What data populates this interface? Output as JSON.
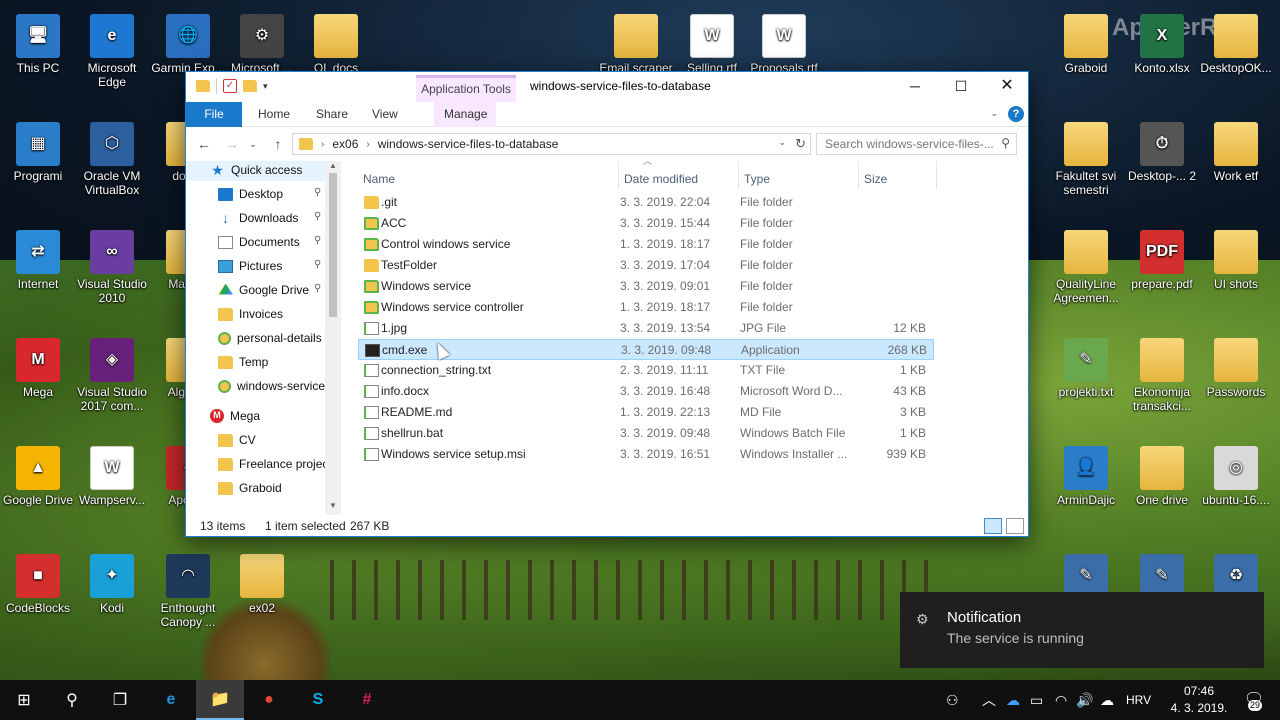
{
  "desktop": {
    "watermark": "ApowerREC",
    "icons": [
      {
        "label": "This PC",
        "glyph": "🖥"
      },
      {
        "label": "Microsoft Edge",
        "glyph": "e"
      },
      {
        "label": "Garmin Exp...",
        "glyph": "🌐"
      },
      {
        "label": "Microsoft ...",
        "glyph": "⚙"
      },
      {
        "label": "OL docs",
        "glyph": ""
      },
      {
        "label": "Email scraper",
        "glyph": ""
      },
      {
        "label": "Selling.rtf",
        "glyph": "W"
      },
      {
        "label": "Proposals.rtf",
        "glyph": "W"
      },
      {
        "label": "Graboid",
        "glyph": ""
      },
      {
        "label": "Konto.xlsx",
        "glyph": "X"
      },
      {
        "label": "DesktopOK...",
        "glyph": ""
      },
      {
        "label": "Programi",
        "glyph": "▦"
      },
      {
        "label": "Oracle VM VirtualBox",
        "glyph": "⬡"
      },
      {
        "label": "dow...",
        "glyph": ""
      },
      {
        "label": "Fakultet svi semestri",
        "glyph": ""
      },
      {
        "label": "Desktop-... 2",
        "glyph": "⏱"
      },
      {
        "label": "Work etf",
        "glyph": ""
      },
      {
        "label": "Internet",
        "glyph": "⇄"
      },
      {
        "label": "Visual Studio 2010",
        "glyph": "∞"
      },
      {
        "label": "Matla...",
        "glyph": ""
      },
      {
        "label": "QualityLine Agreemen...",
        "glyph": ""
      },
      {
        "label": "prepare.pdf",
        "glyph": "PDF"
      },
      {
        "label": "UI shots",
        "glyph": ""
      },
      {
        "label": "Mega",
        "glyph": "M"
      },
      {
        "label": "Visual Studio 2017 com...",
        "glyph": "◈"
      },
      {
        "label": "Algori...",
        "glyph": ""
      },
      {
        "label": "projekti.txt",
        "glyph": "✎"
      },
      {
        "label": "Ekonomija transakci...",
        "glyph": ""
      },
      {
        "label": "Passwords",
        "glyph": ""
      },
      {
        "label": "Google Drive",
        "glyph": "▲"
      },
      {
        "label": "Wampserv...",
        "glyph": "W"
      },
      {
        "label": "Apow...",
        "glyph": "●"
      },
      {
        "label": "ArminDajic",
        "glyph": "👤"
      },
      {
        "label": "One drive",
        "glyph": ""
      },
      {
        "label": "ubuntu-16....",
        "glyph": "◎"
      },
      {
        "label": "CodeBlocks",
        "glyph": "■"
      },
      {
        "label": "Kodi",
        "glyph": "✦"
      },
      {
        "label": "Enthought Canopy ...",
        "glyph": "◠"
      },
      {
        "label": "ex02",
        "glyph": ""
      },
      {
        "label": "",
        "glyph": "✎"
      },
      {
        "label": "",
        "glyph": "✎"
      },
      {
        "label": "",
        "glyph": "♻"
      }
    ]
  },
  "window": {
    "title": "windows-service-files-to-database",
    "context_tab": "Application Tools",
    "controls": {
      "minimize": "─",
      "maximize": "☐",
      "close": "✕"
    },
    "ribbon_tabs": {
      "file": "File",
      "home": "Home",
      "share": "Share",
      "view": "View",
      "manage": "Manage"
    },
    "ribbon_expand": "⌄",
    "help": "?",
    "nav": {
      "back": "←",
      "forward": "→",
      "recent": "⌄",
      "up": "↑"
    },
    "address": {
      "segments": [
        "ex06",
        "windows-service-files-to-database"
      ],
      "chevron": "›",
      "dropdown": "⌄",
      "refresh": "↻"
    },
    "search": {
      "placeholder": "Search windows-service-files-...",
      "icon": "⚲"
    },
    "nav_pane": {
      "quick_access": "Quick access",
      "items": [
        {
          "label": "Desktop",
          "icon": "desktop-icon",
          "pinned": true
        },
        {
          "label": "Downloads",
          "icon": "download-icon",
          "pinned": true
        },
        {
          "label": "Documents",
          "icon": "documents-icon",
          "pinned": true
        },
        {
          "label": "Pictures",
          "icon": "pictures-icon",
          "pinned": true
        },
        {
          "label": "Google Drive",
          "icon": "google-drive-icon",
          "pinned": true
        },
        {
          "label": "Invoices",
          "icon": "folder-icon",
          "pinned": false
        },
        {
          "label": "personal-details",
          "icon": "synced-folder-icon",
          "pinned": false
        },
        {
          "label": "Temp",
          "icon": "folder-icon",
          "pinned": false
        },
        {
          "label": "windows-service",
          "icon": "synced-folder-icon",
          "pinned": false
        }
      ],
      "mega": "Mega",
      "mega_items": [
        "CV",
        "Freelance projec",
        "Graboid"
      ],
      "pin_glyph": "📌",
      "chevron": "›"
    },
    "columns": {
      "name": "Name",
      "date": "Date modified",
      "type": "Type",
      "size": "Size"
    },
    "files": [
      {
        "name": ".git",
        "date": "3. 3. 2019. 22:04",
        "type": "File folder",
        "size": "",
        "kind": "folder"
      },
      {
        "name": "ACC",
        "date": "3. 3. 2019. 15:44",
        "type": "File folder",
        "size": "",
        "kind": "synced"
      },
      {
        "name": "Control windows service",
        "date": "1. 3. 2019. 18:17",
        "type": "File folder",
        "size": "",
        "kind": "synced"
      },
      {
        "name": "TestFolder",
        "date": "3. 3. 2019. 17:04",
        "type": "File folder",
        "size": "",
        "kind": "folder"
      },
      {
        "name": "Windows service",
        "date": "3. 3. 2019. 09:01",
        "type": "File folder",
        "size": "",
        "kind": "synced"
      },
      {
        "name": "Windows service controller",
        "date": "1. 3. 2019. 18:17",
        "type": "File folder",
        "size": "",
        "kind": "synced"
      },
      {
        "name": "1.jpg",
        "date": "3. 3. 2019. 13:54",
        "type": "JPG File",
        "size": "12 KB",
        "kind": "file"
      },
      {
        "name": "cmd.exe",
        "date": "3. 3. 2019. 09:48",
        "type": "Application",
        "size": "268 KB",
        "kind": "exe"
      },
      {
        "name": "connection_string.txt",
        "date": "2. 3. 2019. 11:11",
        "type": "TXT File",
        "size": "1 KB",
        "kind": "file"
      },
      {
        "name": "info.docx",
        "date": "3. 3. 2019. 16:48",
        "type": "Microsoft Word D...",
        "size": "43 KB",
        "kind": "file"
      },
      {
        "name": "README.md",
        "date": "1. 3. 2019. 22:13",
        "type": "MD File",
        "size": "3 KB",
        "kind": "file"
      },
      {
        "name": "shellrun.bat",
        "date": "3. 3. 2019. 09:48",
        "type": "Windows Batch File",
        "size": "1 KB",
        "kind": "file"
      },
      {
        "name": "Windows service setup.msi",
        "date": "3. 3. 2019. 16:51",
        "type": "Windows Installer ...",
        "size": "939 KB",
        "kind": "file"
      }
    ],
    "selected_file": "cmd.exe",
    "status": {
      "count": "13 items",
      "selection": "1 item selected",
      "size": "267 KB"
    }
  },
  "notification": {
    "title": "Notification",
    "body": "The service is running",
    "icon": "⚙"
  },
  "taskbar": {
    "start": "⊞",
    "search": "⚲",
    "taskview": "❐",
    "apps": [
      {
        "name": "edge",
        "glyph": "e",
        "color": "#1e90e0"
      },
      {
        "name": "file-explorer",
        "glyph": "📁",
        "color": "#f3c54d"
      },
      {
        "name": "chrome",
        "glyph": "●",
        "color": "#e0483a"
      },
      {
        "name": "skype",
        "glyph": "S",
        "color": "#00aff0"
      },
      {
        "name": "slack",
        "glyph": "#",
        "color": "#e01e5a"
      }
    ],
    "tray": {
      "people": "⚇",
      "chevron": "︿",
      "onedrive": "☁",
      "battery": "▭",
      "wifi": "◠",
      "volume": "🔊",
      "cloud": "☁",
      "language": "HRV"
    },
    "time": "07:46",
    "date": "4. 3. 2019.",
    "notif_count": "29"
  }
}
